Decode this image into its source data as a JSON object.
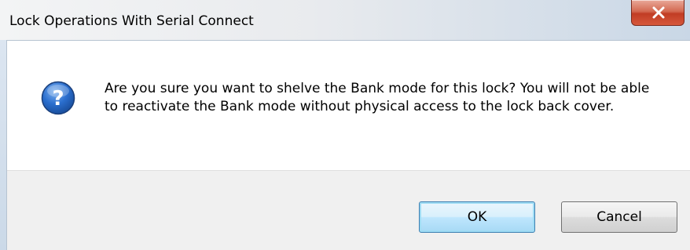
{
  "window": {
    "title": "Lock Operations With Serial Connect"
  },
  "dialog": {
    "icon": "question-icon",
    "message": "Are you sure you want to shelve the Bank mode for this lock?  You will not be able to reactivate the Bank mode without physical access to the lock back cover."
  },
  "buttons": {
    "ok_label": "OK",
    "cancel_label": "Cancel",
    "close_icon": "close-icon"
  },
  "colors": {
    "close_button": "#c13c24",
    "icon_blue": "#1f5fbf",
    "default_button_border": "#3c7fb1"
  }
}
